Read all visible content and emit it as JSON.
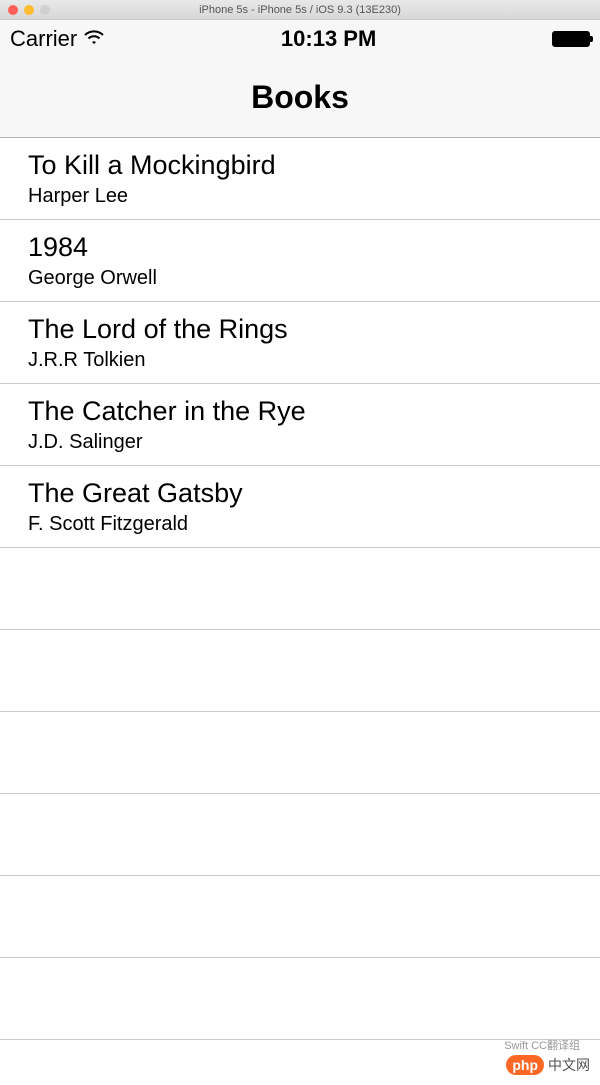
{
  "window": {
    "title": "iPhone 5s - iPhone 5s / iOS 9.3 (13E230)"
  },
  "statusBar": {
    "carrier": "Carrier",
    "time": "10:13 PM"
  },
  "navBar": {
    "title": "Books"
  },
  "books": [
    {
      "title": "To Kill a Mockingbird",
      "author": "Harper Lee"
    },
    {
      "title": "1984",
      "author": "George Orwell"
    },
    {
      "title": "The Lord of the Rings",
      "author": "J.R.R Tolkien"
    },
    {
      "title": "The Catcher in the Rye",
      "author": "J.D. Salinger"
    },
    {
      "title": "The Great Gatsby",
      "author": "F. Scott Fitzgerald"
    }
  ],
  "emptyRows": 6,
  "watermark": {
    "sub": "Swift CC翻译组",
    "badge": "php",
    "text": "中文网"
  }
}
